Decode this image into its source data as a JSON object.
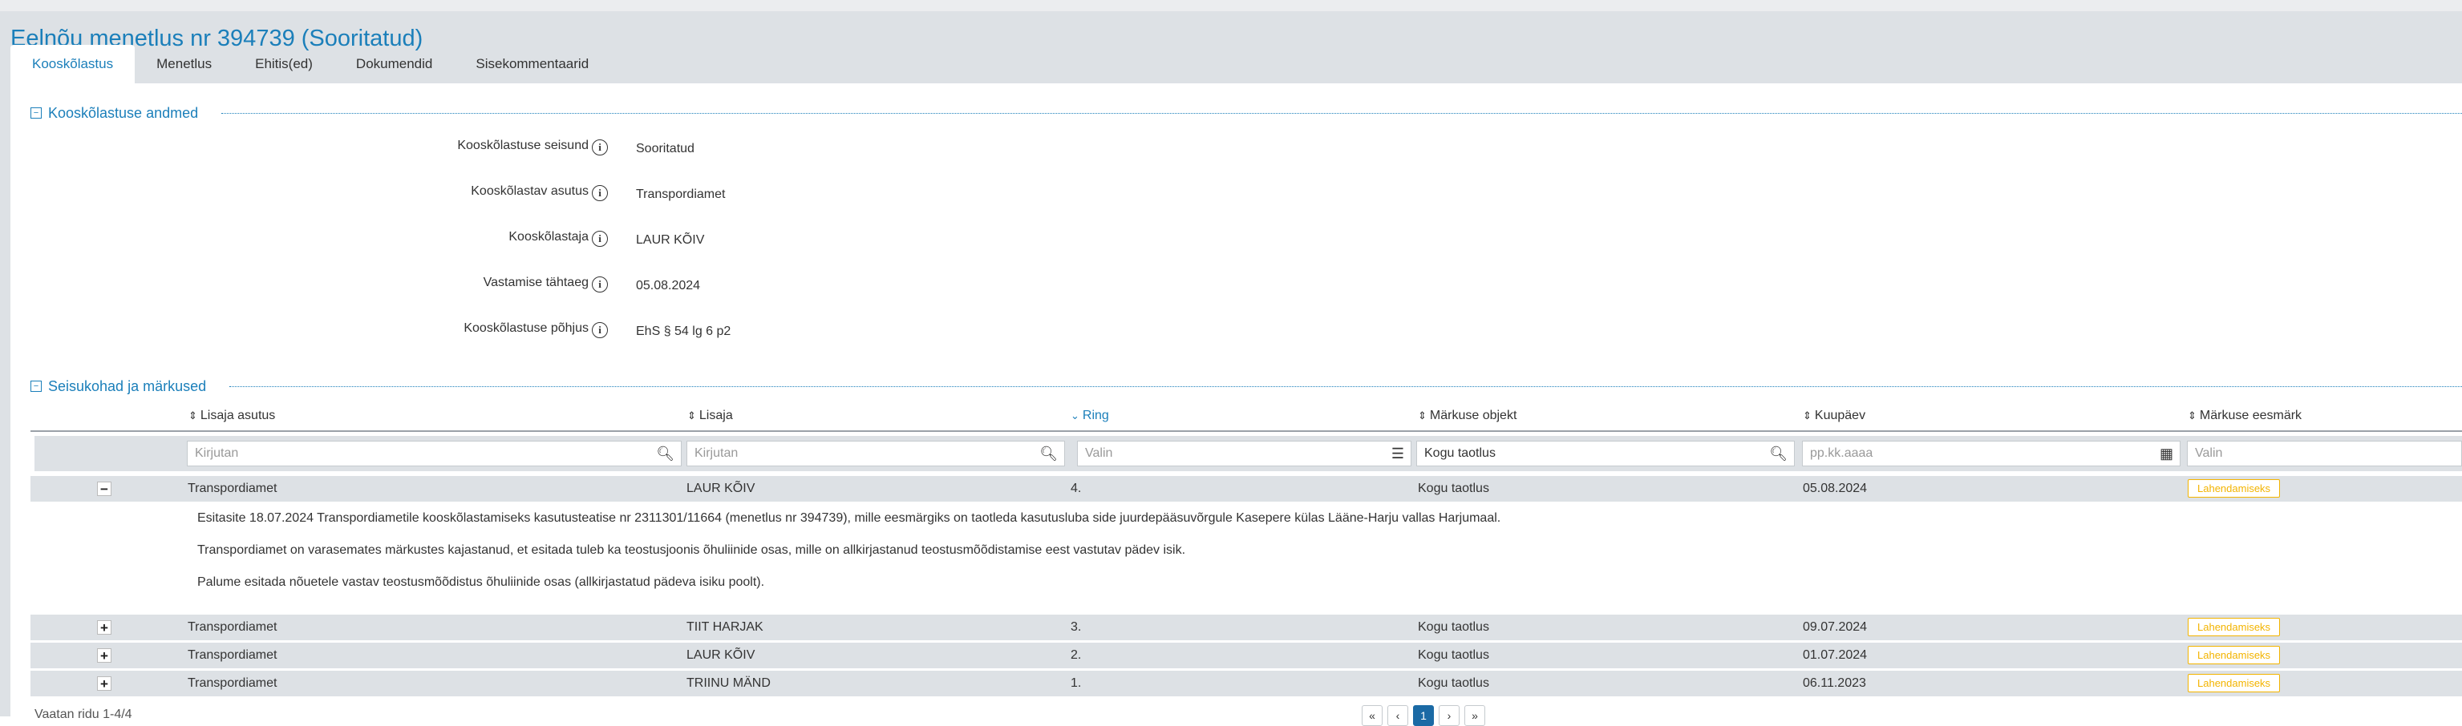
{
  "page": {
    "title": "Eelnõu menetlus nr 394739 (Sooritatud)"
  },
  "tabs": [
    {
      "label": "Kooskõlastus",
      "active": true
    },
    {
      "label": "Menetlus"
    },
    {
      "label": "Ehitis(ed)"
    },
    {
      "label": "Dokumendid"
    },
    {
      "label": "Sisekommentaarid"
    }
  ],
  "section1": {
    "title": "Kooskõlastuse andmed",
    "toggle": "−",
    "fields": [
      {
        "label": "Kooskõlastuse seisund",
        "value": "Sooritatud"
      },
      {
        "label": "Kooskõlastav asutus",
        "value": "Transpordiamet"
      },
      {
        "label": "Kooskõlastaja",
        "value": "LAUR KÕIV"
      },
      {
        "label": "Vastamise tähtaeg",
        "value": "05.08.2024"
      },
      {
        "label": "Kooskõlastuse põhjus",
        "value": "EhS § 54 lg 6 p2"
      }
    ]
  },
  "section2": {
    "title": "Seisukohad ja märkused",
    "toggle": "−",
    "columns": [
      "Lisaja asutus",
      "Lisaja",
      "Ring",
      "Märkuse objekt",
      "Kuupäev",
      "Märkuse eesmärk"
    ],
    "active_sort_column": "Ring",
    "filters": {
      "lisaja_asutus": {
        "placeholder": "Kirjutan"
      },
      "lisaja": {
        "placeholder": "Kirjutan"
      },
      "ring": {
        "placeholder": "Valin"
      },
      "objekt": {
        "value": "Kogu taotlus"
      },
      "kuupaev": {
        "placeholder": "pp.kk.aaaa"
      },
      "eesmark": {
        "placeholder": "Valin"
      }
    },
    "rows": [
      {
        "toggle": "−",
        "asutus": "Transpordiamet",
        "lisaja": "LAUR KÕIV",
        "ring": "4.",
        "objekt": "Kogu taotlus",
        "kuupaev": "05.08.2024",
        "eesmark": "Lahendamiseks"
      },
      {
        "toggle": "+",
        "asutus": "Transpordiamet",
        "lisaja": "TIIT HARJAK",
        "ring": "3.",
        "objekt": "Kogu taotlus",
        "kuupaev": "09.07.2024",
        "eesmark": "Lahendamiseks"
      },
      {
        "toggle": "+",
        "asutus": "Transpordiamet",
        "lisaja": "LAUR KÕIV",
        "ring": "2.",
        "objekt": "Kogu taotlus",
        "kuupaev": "01.07.2024",
        "eesmark": "Lahendamiseks"
      },
      {
        "toggle": "+",
        "asutus": "Transpordiamet",
        "lisaja": "TRIINU MÄND",
        "ring": "1.",
        "objekt": "Kogu taotlus",
        "kuupaev": "06.11.2023",
        "eesmark": "Lahendamiseks"
      }
    ],
    "detail": [
      "Esitasite 18.07.2024 Transpordiametile kooskõlastamiseks kasutusteatise nr 2311301/11664 (menetlus nr 394739), mille eesmärgiks on taotleda kasutusluba side juurdepääsuvõrgule Kasepere külas Lääne-Harju vallas Harjumaal.",
      "Transpordiamet on varasemates märkustes kajastanud, et esitada tuleb ka teostusjoonis õhuliinide osas, mille on allkirjastanud teostusmõõdistamise eest vastutav pädev isik.",
      "Palume esitada nõuetele vastav teostusmõõdistus õhuliinide osas (allkirjastatud pädeva isiku poolt)."
    ]
  },
  "pagination": {
    "info": "Vaatan ridu 1-4/4",
    "current_page": "1"
  },
  "colors": {
    "accent": "#1b7fba",
    "badge": "#f3b400",
    "header_bg": "#dde1e5"
  }
}
